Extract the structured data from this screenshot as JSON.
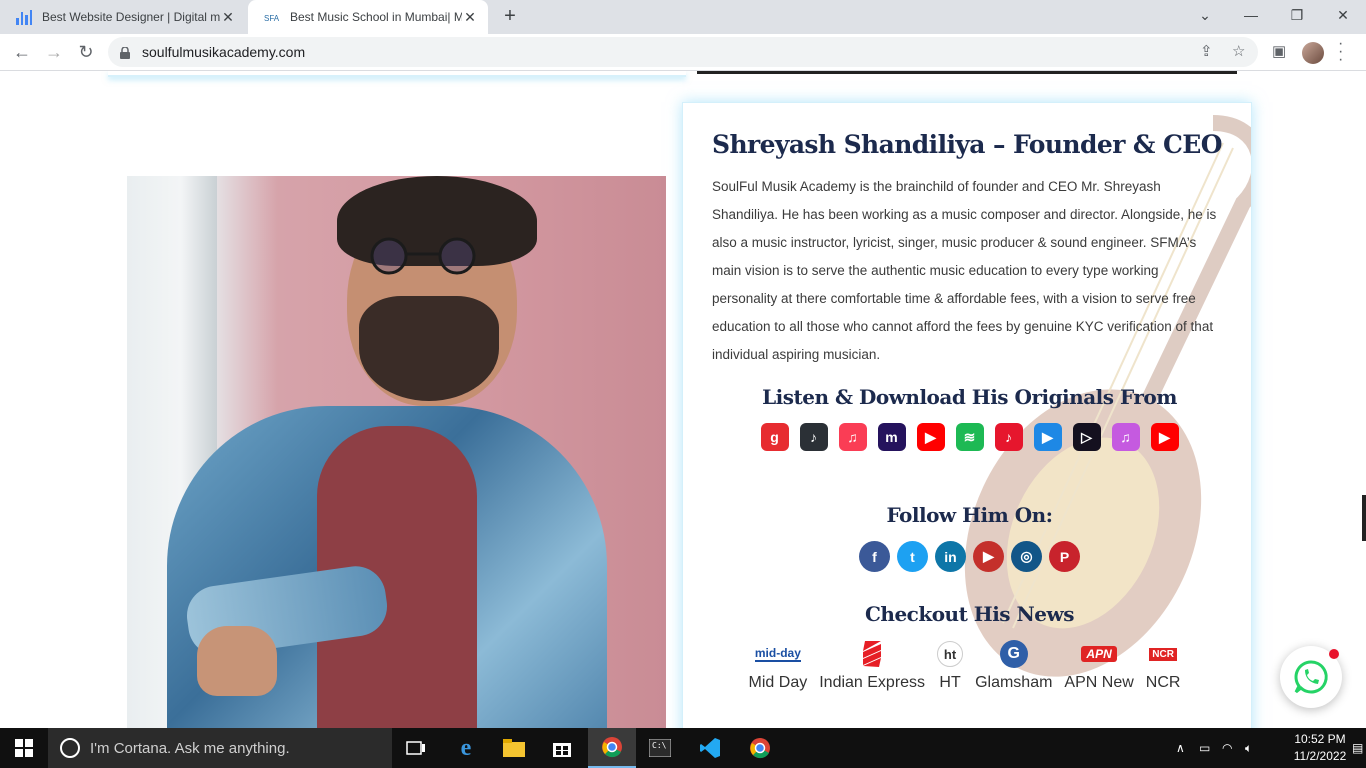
{
  "browser": {
    "tabs": [
      {
        "title": "Best Website Designer | Digital m",
        "active": false
      },
      {
        "title": "Best Music School in Mumbai| M",
        "active": true
      }
    ],
    "url": "soulfulmusikacademy.com"
  },
  "card": {
    "title": "Shreyash Shandiliya – Founder & CEO",
    "description": "SoulFul Musik Academy is the brainchild of founder and CEO Mr. Shreyash Shandiliya. He has been working as a music composer and director. Alongside, he is also a music instructor, lyricist, singer, music producer & sound engineer. SFMA’s main vision is to serve the authentic music education to every type working personality at there comfortable time & affordable fees, with a vision to serve free education to all those who cannot afford the fees by genuine KYC verification of that individual aspiring musician.",
    "listen_heading": "Listen & Download His Originals From",
    "music_platforms": [
      {
        "icon": "gaana-icon",
        "color": "#e72c30",
        "glyph": "g"
      },
      {
        "icon": "jiosaavn-icon",
        "color": "#2b3036",
        "glyph": "♪"
      },
      {
        "icon": "apple-music-icon",
        "color": "#fa3d55",
        "glyph": "♫"
      },
      {
        "icon": "amazon-music-icon",
        "color": "#25135d",
        "glyph": "m"
      },
      {
        "icon": "youtube-music-icon",
        "color": "#ff0000",
        "glyph": "▶"
      },
      {
        "icon": "spotify-icon",
        "color": "#1db954",
        "glyph": "≋"
      },
      {
        "icon": "resso-icon",
        "color": "#e6162d",
        "glyph": "♪"
      },
      {
        "icon": "google-play-icon",
        "color": "#1e88e5",
        "glyph": "▶"
      },
      {
        "icon": "wynk-icon",
        "color": "#14101f",
        "glyph": "▷"
      },
      {
        "icon": "itunes-icon",
        "color": "#c55ae0",
        "glyph": "♫"
      },
      {
        "icon": "youtube-icon",
        "color": "#ff0000",
        "glyph": "▶"
      }
    ],
    "follow_heading": "Follow Him On:",
    "social": [
      {
        "icon": "facebook-icon",
        "color": "#3b5998",
        "glyph": "f"
      },
      {
        "icon": "twitter-icon",
        "color": "#1da1f2",
        "glyph": "t"
      },
      {
        "icon": "linkedin-icon",
        "color": "#0e76a8",
        "glyph": "in"
      },
      {
        "icon": "youtube-icon",
        "color": "#c4302b",
        "glyph": "▶"
      },
      {
        "icon": "instagram-icon",
        "color": "#125688",
        "glyph": "◎"
      },
      {
        "icon": "pinterest-icon",
        "color": "#c8232c",
        "glyph": "P"
      }
    ],
    "news_heading": "Checkout His News",
    "news": [
      {
        "label": "Mid Day",
        "logo": "mid-day"
      },
      {
        "label": "Indian Express",
        "logo": ""
      },
      {
        "label": "HT",
        "logo": "ht"
      },
      {
        "label": "Glamsham",
        "logo": "G"
      },
      {
        "label": "APN New",
        "logo": "APN"
      },
      {
        "label": "NCR",
        "logo": "NCR"
      }
    ]
  },
  "taskbar": {
    "search_placeholder": "I'm Cortana. Ask me anything.",
    "time": "10:52 PM",
    "date": "11/2/2022"
  },
  "colors": {
    "heading": "#1c2a4d",
    "card_glow": "#78d2f5",
    "whatsapp": "#25d366"
  }
}
